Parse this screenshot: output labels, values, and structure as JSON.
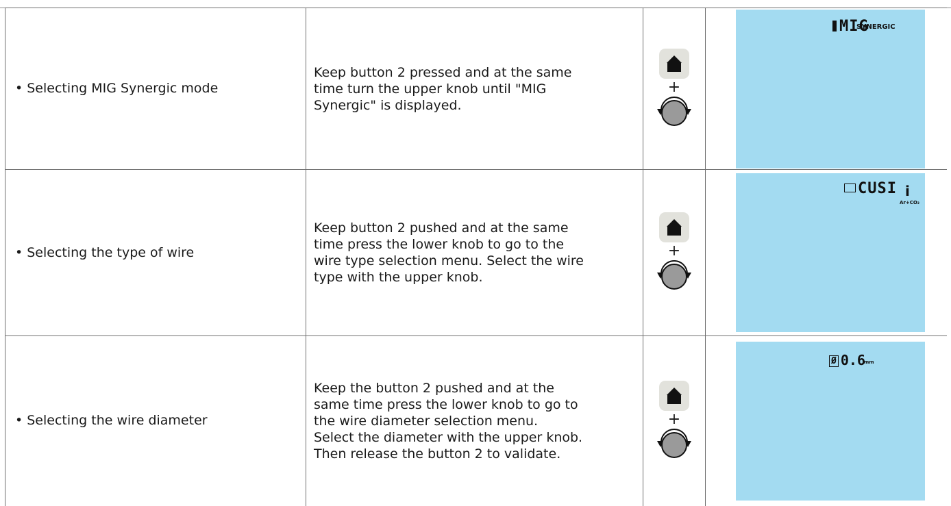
{
  "rows": [
    {
      "title": "• Selecting MIG Synergic mode",
      "desc": [
        "Keep button 2 pressed and at the same",
        "time turn the upper knob until \"MIG",
        "Synergic\" is displayed."
      ],
      "control": {
        "button_icon": "home-arrow-icon",
        "plus": "+",
        "knob_icon": "rotary-knob-icon"
      },
      "display": {
        "main": "MIG",
        "sub": "SYNERGIC"
      }
    },
    {
      "title": "• Selecting the type of wire",
      "desc": [
        "Keep button 2 pushed and at the same",
        "time press the lower knob to go to the",
        "wire type selection menu. Select the wire",
        "type with the upper knob."
      ],
      "control": {
        "button_icon": "home-arrow-icon",
        "plus": "+",
        "knob_icon": "rotary-knob-icon"
      },
      "display": {
        "main": "CUSI",
        "info": "i",
        "gas": "Ar+CO₂"
      }
    },
    {
      "title": "• Selecting the wire diameter",
      "desc": [
        "Keep the button 2 pushed and at the",
        "same time press the lower knob to go to",
        "the wire diameter selection menu.",
        "Select the diameter with the upper knob.",
        "Then release the button 2 to validate."
      ],
      "control": {
        "button_icon": "home-arrow-icon",
        "plus": "+",
        "knob_icon": "rotary-knob-icon"
      },
      "display": {
        "symbol": "Ø",
        "main": "0.6",
        "unit": "mm"
      }
    }
  ],
  "colors": {
    "lcd": "#a3dbf1",
    "button": "#e2e2dc",
    "knob": "#9a9a9a",
    "border": "#6e6e6e"
  }
}
